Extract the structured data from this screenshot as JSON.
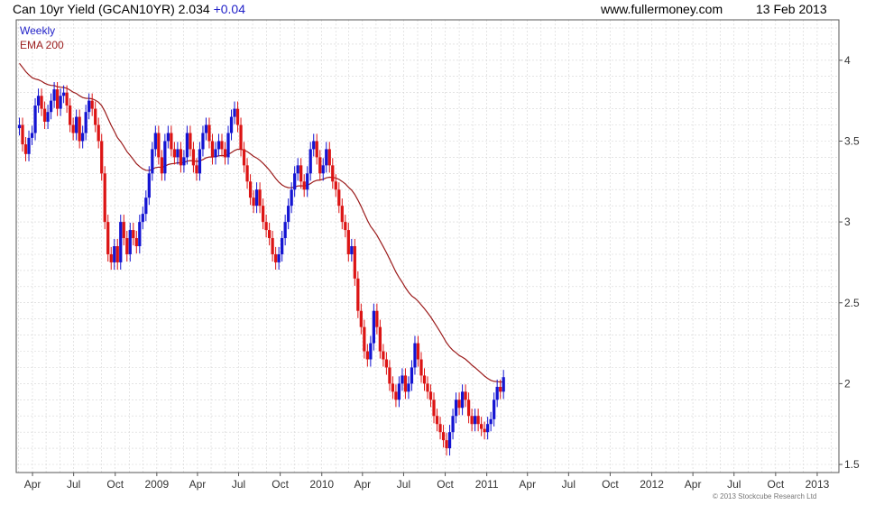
{
  "header": {
    "title": "Can 10yr Yield (GCAN10YR) 2.034",
    "change": "+0.04",
    "site": "www.fullermoney.com",
    "date": "13 Feb 2013"
  },
  "copyright": "© 2013 Stockcube Research Ltd",
  "colors": {
    "up": "#1414d2",
    "down": "#dc1414",
    "ema": "#9b1b1b",
    "grid": "#d4d4d4",
    "frame": "#555555",
    "legend_weekly": "#1f1fc8",
    "legend_ema": "#9b1b1b"
  },
  "chart_data": {
    "type": "candlestick",
    "interval": "Weekly",
    "ema_label": "EMA 200",
    "ylim": [
      1.45,
      4.25
    ],
    "yticks": [
      1.5,
      2,
      2.5,
      3,
      3.5,
      4
    ],
    "ytick_labels": [
      "1.5",
      "2",
      "2.5",
      "3",
      "3.5",
      "4"
    ],
    "xlim": [
      "2008-02-25",
      "2013-02-18"
    ],
    "xticks": [
      "2008-04-01",
      "2008-07-01",
      "2008-10-01",
      "2009-01-01",
      "2009-04-01",
      "2009-07-01",
      "2009-10-01",
      "2010-01-01",
      "2010-04-01",
      "2010-07-01",
      "2010-10-01",
      "2011-01-01",
      "2011-04-01",
      "2011-07-01",
      "2011-10-01",
      "2012-01-01",
      "2012-04-01",
      "2012-07-01",
      "2012-10-01",
      "2013-01-01"
    ],
    "xtick_labels": [
      "Apr",
      "Jul",
      "Oct",
      "2009",
      "Apr",
      "Jul",
      "Oct",
      "2010",
      "Apr",
      "Jul",
      "Oct",
      "2011",
      "Apr",
      "Jul",
      "Oct",
      "2012",
      "Apr",
      "Jul",
      "Oct",
      "2013"
    ],
    "weekly_close": [
      3.6,
      3.48,
      3.42,
      3.52,
      3.55,
      3.72,
      3.78,
      3.7,
      3.62,
      3.68,
      3.75,
      3.82,
      3.7,
      3.78,
      3.8,
      3.72,
      3.6,
      3.55,
      3.65,
      3.5,
      3.55,
      3.68,
      3.75,
      3.7,
      3.6,
      3.5,
      3.3,
      3.0,
      2.8,
      2.75,
      2.85,
      2.75,
      3.0,
      2.9,
      2.8,
      2.95,
      2.9,
      2.85,
      3.0,
      3.05,
      3.15,
      3.3,
      3.45,
      3.55,
      3.4,
      3.3,
      3.5,
      3.55,
      3.45,
      3.4,
      3.45,
      3.35,
      3.4,
      3.55,
      3.45,
      3.35,
      3.3,
      3.45,
      3.55,
      3.6,
      3.5,
      3.4,
      3.45,
      3.5,
      3.45,
      3.4,
      3.55,
      3.65,
      3.7,
      3.6,
      3.45,
      3.35,
      3.25,
      3.15,
      3.1,
      3.2,
      3.1,
      3.0,
      2.95,
      2.9,
      2.8,
      2.75,
      2.8,
      2.9,
      3.0,
      3.1,
      3.2,
      3.3,
      3.35,
      3.25,
      3.2,
      3.3,
      3.45,
      3.5,
      3.4,
      3.3,
      3.35,
      3.45,
      3.35,
      3.25,
      3.2,
      3.1,
      3.0,
      2.95,
      2.8,
      2.85,
      2.65,
      2.45,
      2.35,
      2.2,
      2.15,
      2.25,
      2.45,
      2.35,
      2.2,
      2.15,
      2.1,
      2.0,
      1.95,
      1.9,
      2.0,
      2.05,
      1.95,
      2.0,
      2.1,
      2.25,
      2.15,
      2.05,
      2.0,
      1.95,
      1.9,
      1.8,
      1.75,
      1.7,
      1.65,
      1.6,
      1.7,
      1.8,
      1.9,
      1.85,
      1.95,
      1.9,
      1.8,
      1.75,
      1.8,
      1.75,
      1.72,
      1.7,
      1.75,
      1.78,
      1.9,
      1.98,
      1.95,
      2.04
    ]
  }
}
